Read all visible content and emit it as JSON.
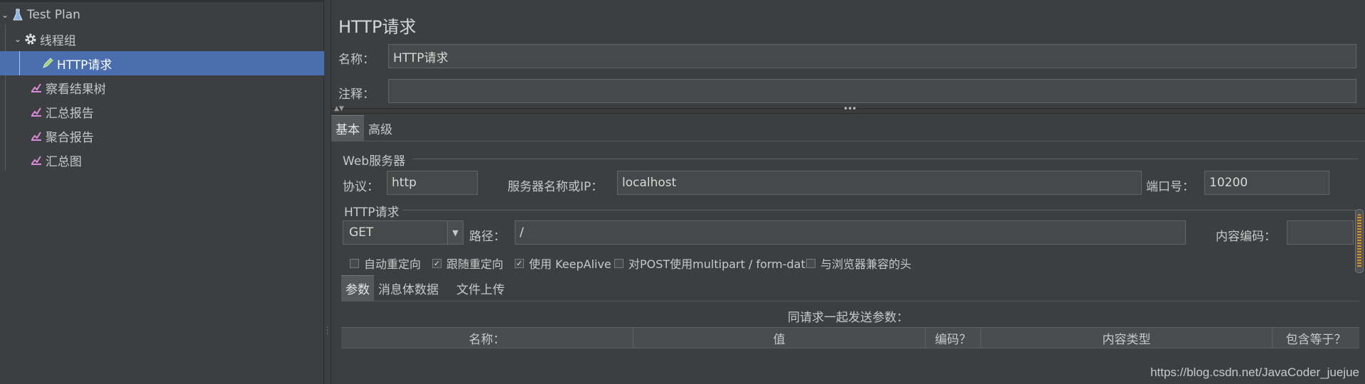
{
  "tree": {
    "items": [
      {
        "label": "Test Plan",
        "icon": "flask-icon",
        "expanded": true
      },
      {
        "label": "线程组",
        "icon": "gear-icon",
        "expanded": true
      },
      {
        "label": "HTTP请求",
        "icon": "pen-icon",
        "selected": true
      },
      {
        "label": "察看结果树",
        "icon": "graph-icon"
      },
      {
        "label": "汇总报告",
        "icon": "graph-icon"
      },
      {
        "label": "聚合报告",
        "icon": "graph-icon"
      },
      {
        "label": "汇总图",
        "icon": "graph-icon"
      }
    ]
  },
  "panel": {
    "title": "HTTP请求",
    "name_label": "名称：",
    "name_value": "HTTP请求",
    "comment_label": "注释：",
    "comment_value": ""
  },
  "tabs": {
    "basic": "基本",
    "advanced": "高级"
  },
  "web_server": {
    "group_title": "Web服务器",
    "protocol_label": "协议：",
    "protocol_value": "http",
    "server_label": "服务器名称或IP：",
    "server_value": "localhost",
    "port_label": "端口号：",
    "port_value": "10200"
  },
  "http_request": {
    "group_title": "HTTP请求",
    "method": "GET",
    "path_label": "路径：",
    "path_value": "/",
    "encoding_label": "内容编码：",
    "encoding_value": ""
  },
  "options": [
    {
      "label": "自动重定向",
      "checked": false
    },
    {
      "label": "跟随重定向",
      "checked": true
    },
    {
      "label": "使用 KeepAlive",
      "checked": true
    },
    {
      "label": "对POST使用multipart / form-data",
      "checked": false
    },
    {
      "label": "与浏览器兼容的头",
      "checked": false
    }
  ],
  "subtabs": {
    "params": "参数",
    "body": "消息体数据",
    "files": "文件上传"
  },
  "params_table": {
    "caption": "同请求一起发送参数：",
    "columns": [
      "名称：",
      "值",
      "编码？",
      "内容类型",
      "包含等于？"
    ]
  },
  "watermark": "https://blog.csdn.net/JavaCoder_juejue",
  "colors": {
    "selection": "#4b6eaf",
    "background": "#3c3f41"
  }
}
